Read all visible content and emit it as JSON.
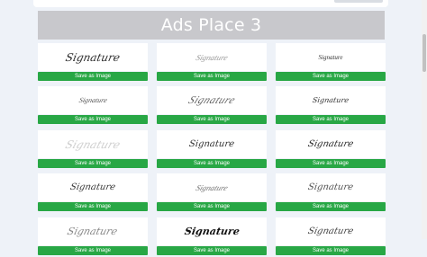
{
  "banner": {
    "title": "Ads Place 3"
  },
  "cards": [
    {
      "signature": "Signature",
      "button": "Save as Image"
    },
    {
      "signature": "Signature",
      "button": "Save as Image"
    },
    {
      "signature": "Signature",
      "button": "Save as Image"
    },
    {
      "signature": "Signature",
      "button": "Save as Image"
    },
    {
      "signature": "Signature",
      "button": "Save as Image"
    },
    {
      "signature": "Signature",
      "button": "Save as Image"
    },
    {
      "signature": "Signature",
      "button": "Save as Image"
    },
    {
      "signature": "Signature",
      "button": "Save as Image"
    },
    {
      "signature": "Signature",
      "button": "Save as Image"
    },
    {
      "signature": "Signature",
      "button": "Save as Image"
    },
    {
      "signature": "Signature",
      "button": "Save as Image"
    },
    {
      "signature": "Signature",
      "button": "Save as Image"
    },
    {
      "signature": "Signature",
      "button": "Save as Image"
    },
    {
      "signature": "Signature",
      "button": "Save as Image"
    },
    {
      "signature": "Signature",
      "button": "Save as Image"
    }
  ],
  "colors": {
    "button": "#28a745",
    "banner": "#c8c8cc",
    "page_background": "#eef2f8"
  }
}
